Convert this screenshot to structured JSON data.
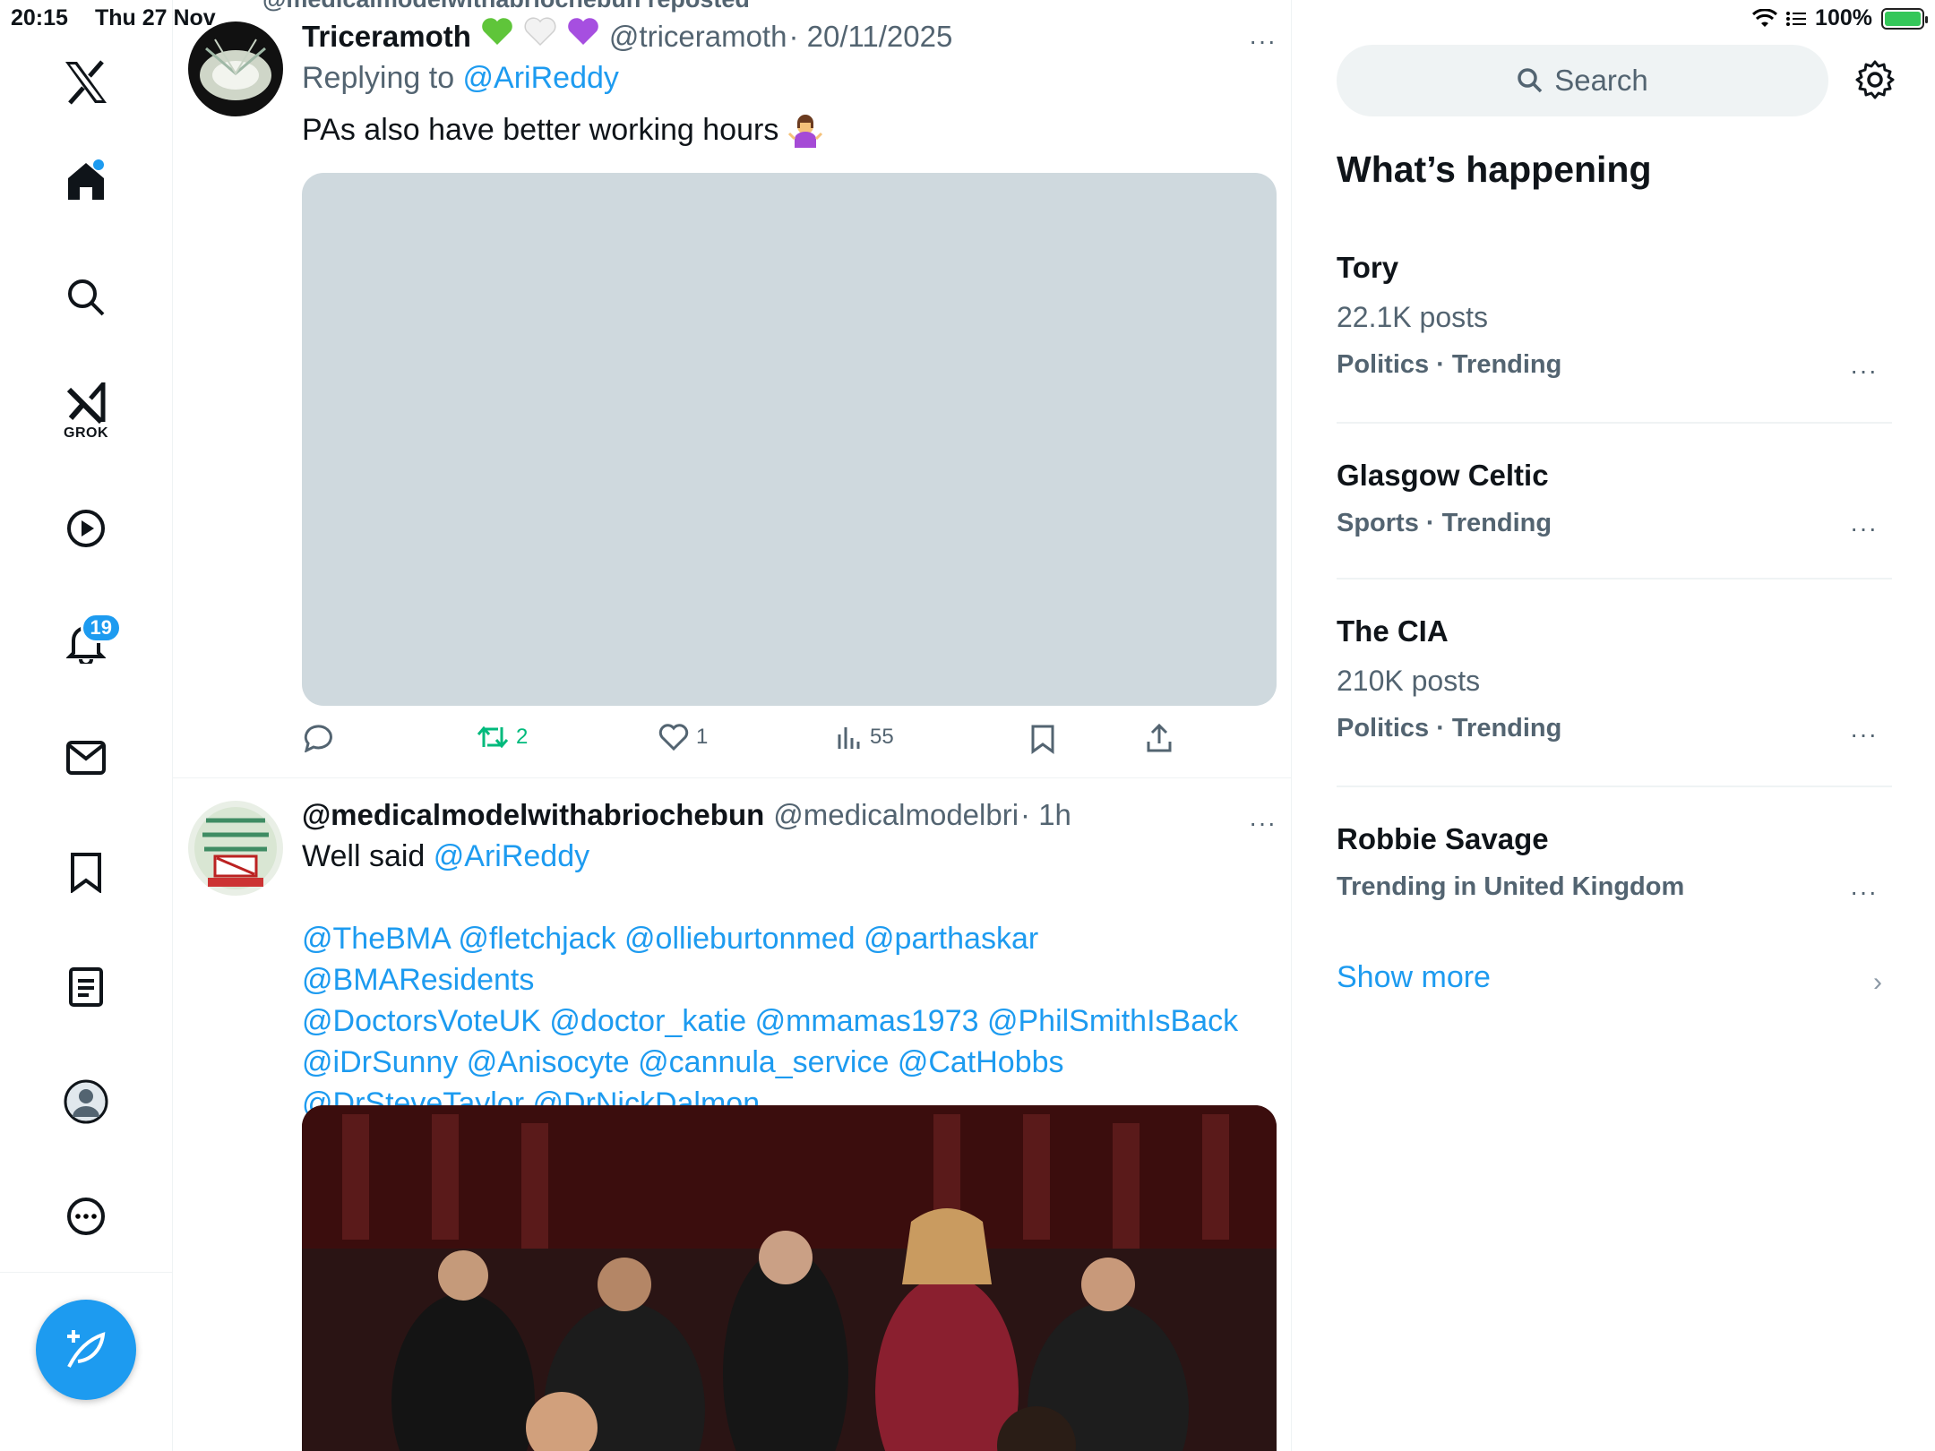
{
  "status_bar": {
    "time": "20:15",
    "date": "Thu 27 Nov",
    "battery": "100%",
    "battery_level": 1.0
  },
  "nav": {
    "items": [
      "x-logo",
      "home",
      "explore",
      "grok",
      "video",
      "notifications",
      "messages",
      "bookmarks",
      "lists",
      "profile",
      "more"
    ],
    "grok_label": "GROK",
    "notifications_badge": "19"
  },
  "feed": {
    "repost_banner": "@medicalmodelwithabriochebun reposted",
    "tweet1": {
      "name": "Triceramoth",
      "emojis": [
        "green-heart",
        "white-heart",
        "purple-heart"
      ],
      "handle": "@triceramoth",
      "date": "· 20/11/2025",
      "reply_prefix": "Replying to ",
      "reply_to": "@AriReddy",
      "text": "PAs also have better working hours",
      "text_emoji": "woman-shrugging",
      "more": "···",
      "actions": {
        "reply": "",
        "repost": "2",
        "like": "1",
        "views": "55"
      }
    },
    "tweet2": {
      "name": "@medicalmodelwithabriochebun",
      "handle": "@medicalmodelbri",
      "time": "· 1h",
      "text_prefix": "Well said ",
      "text_mention": "@AriReddy",
      "mentions_line1": "@TheBMA @fletchjack @ollieburtonmed @parthaskar @BMAResidents",
      "mentions_line2": "@DoctorsVoteUK @doctor_katie @mmamas1973 @PhilSmithIsBack",
      "mentions_line3": "@iDrSunny @Anisocyte @cannula_service @CatHobbs",
      "mentions_line4": "@DrSteveTaylor @DrNickDalmon",
      "more": "···"
    }
  },
  "sidebar": {
    "search_placeholder": "Search",
    "title": "What’s happening",
    "trends": [
      {
        "name": "Tory",
        "posts": "22.1K posts",
        "category": "Politics · Trending"
      },
      {
        "name": "Glasgow Celtic",
        "posts": "",
        "category": "Sports · Trending"
      },
      {
        "name": "The CIA",
        "posts": "210K posts",
        "category": "Politics · Trending"
      },
      {
        "name": "Robbie Savage",
        "posts": "",
        "category": "Trending in United Kingdom"
      }
    ],
    "more_dots": "···",
    "show_more": "Show more",
    "chevron": "›"
  },
  "colors": {
    "accent": "#1d9bf0",
    "repost_green": "#00ba7c",
    "text_secondary": "#536471",
    "placeholder_media": "#cfd9de"
  }
}
